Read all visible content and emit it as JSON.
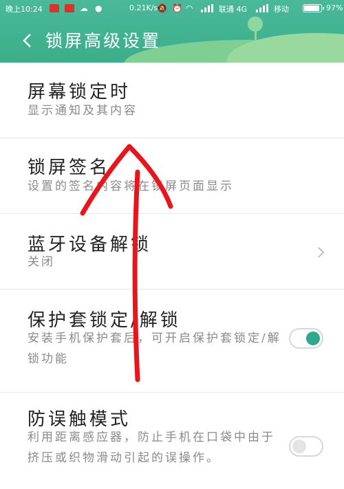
{
  "status_bar": {
    "time": "晚上10:24",
    "network_speed": "0.21K/s",
    "carrier1": "联通 4G",
    "carrier2": "移动",
    "battery": "97%",
    "battery_level": 0.97
  },
  "header": {
    "title": "锁屏高级设置",
    "accent_color": "#3bae88"
  },
  "settings": [
    {
      "title": "屏幕锁定时",
      "subtitle": "显示通知及其内容",
      "control": "none"
    },
    {
      "title": "锁屏签名",
      "subtitle": "设置的签名内容将在锁屏页面显示",
      "control": "none"
    },
    {
      "title": "蓝牙设备解锁",
      "subtitle": "关闭",
      "control": "chevron"
    },
    {
      "title": "保护套锁定/解锁",
      "subtitle": "安装手机保护套后，可开启保护套锁定/解锁功能",
      "control": "toggle",
      "toggle_on": true
    },
    {
      "title": "防误触模式",
      "subtitle": "利用距离感应器，防止手机在口袋中由于挤压或织物滑动引起的误操作。",
      "control": "toggle",
      "toggle_on": false
    }
  ],
  "annotation": {
    "color": "#e8151b",
    "shape": "upward-arrow"
  }
}
